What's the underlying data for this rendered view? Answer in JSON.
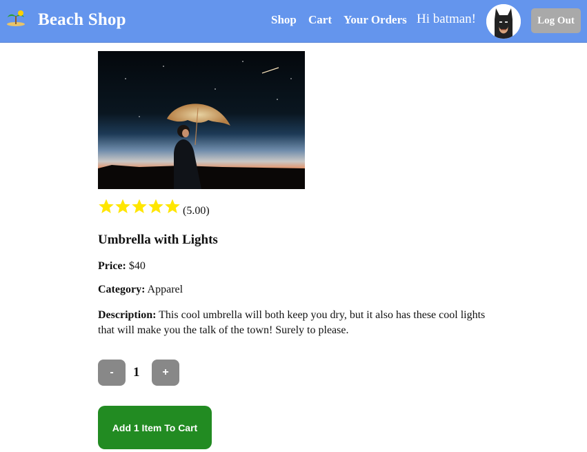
{
  "nav": {
    "brand": "Beach Shop",
    "logo_icon": "island-icon",
    "links": [
      "Shop",
      "Cart",
      "Your Orders"
    ],
    "greeting": "Hi batman!",
    "avatar": "batman-avatar",
    "logout_label": "Log Out",
    "bar_color": "#6495ed"
  },
  "product": {
    "image": "umbrella-with-lights-photo",
    "stars": 5,
    "rating_text": "(5.00)",
    "name": "Umbrella with Lights",
    "price_label": "Price:",
    "price_value": "$40",
    "category_label": "Category:",
    "category_value": "Apparel",
    "description_label": "Description:",
    "description_value": "This cool umbrella will both keep you dry, but it also has these cool lights that will make you the talk of the town! Surely to please."
  },
  "quantity": {
    "minus_label": "-",
    "value": "1",
    "plus_label": "+"
  },
  "cart": {
    "add_label": "Add 1 Item To Cart",
    "button_color": "#228b22"
  }
}
